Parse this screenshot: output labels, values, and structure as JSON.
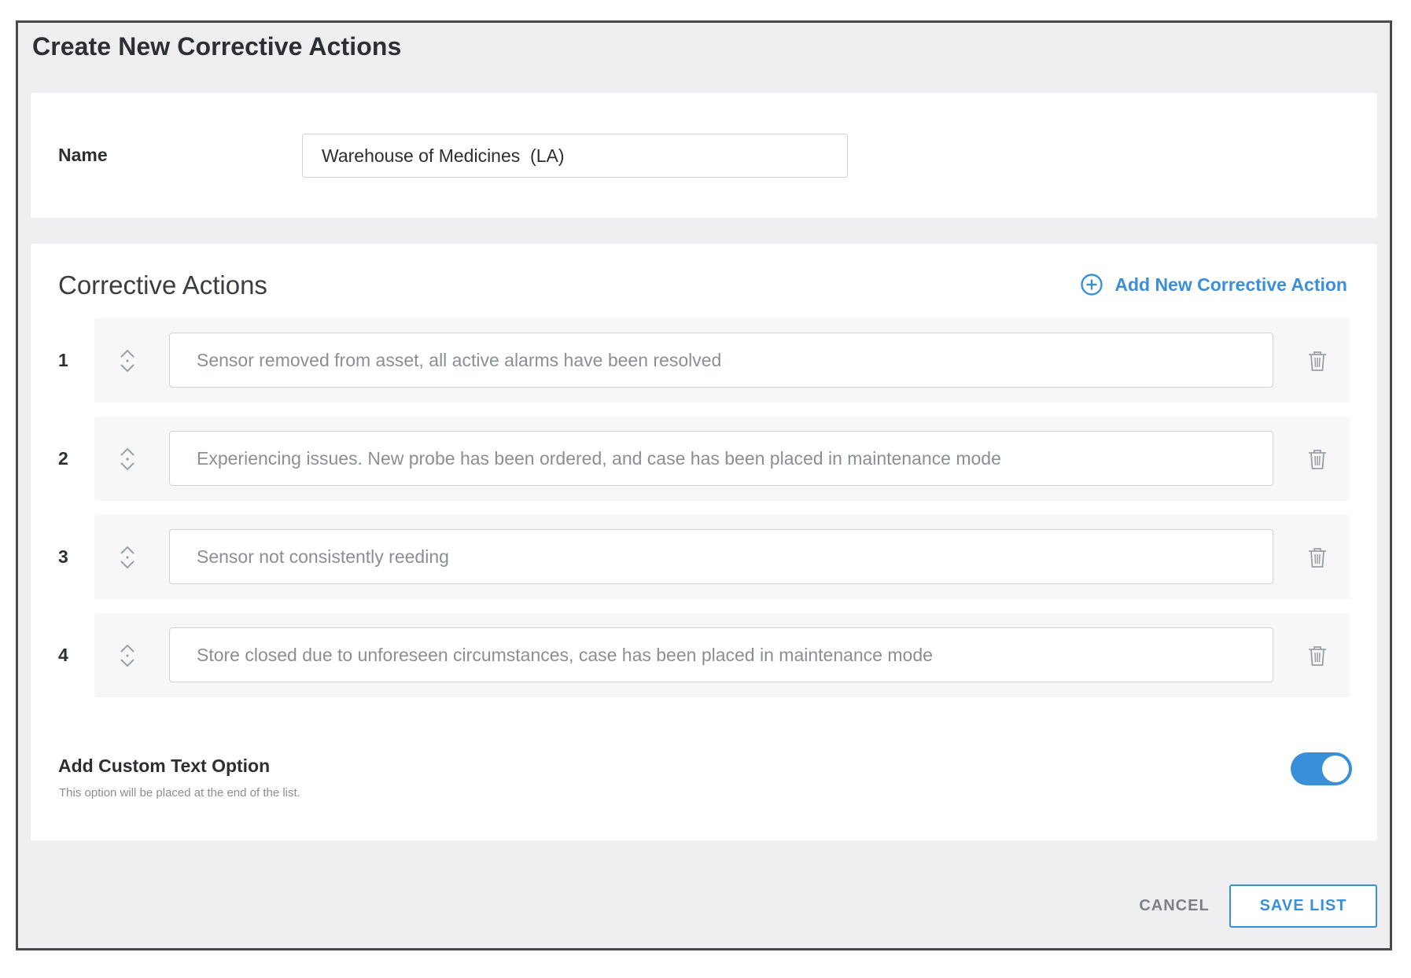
{
  "dialog": {
    "title": "Create New Corrective Actions"
  },
  "name_field": {
    "label": "Name",
    "value": "Warehouse of Medicines  (LA)"
  },
  "actions_section": {
    "title": "Corrective Actions",
    "add_label": "Add New Corrective Action",
    "items": [
      {
        "number": "1",
        "text": "Sensor removed from asset, all active alarms have been resolved"
      },
      {
        "number": "2",
        "text": "Experiencing issues. New probe has been ordered, and case has been placed in maintenance mode"
      },
      {
        "number": "3",
        "text": "Sensor not consistently reeding"
      },
      {
        "number": "4",
        "text": "Store closed due to unforeseen circumstances, case has been placed in maintenance mode"
      }
    ]
  },
  "custom_text": {
    "label": "Add Custom Text Option",
    "help": "This option will be placed at the end of the list.",
    "enabled": true
  },
  "footer": {
    "cancel_label": "CANCEL",
    "save_label": "SAVE LIST"
  },
  "colors": {
    "accent": "#3a8fd9",
    "dialog_bg": "#efeff1",
    "card_bg": "#ffffff",
    "row_bg": "#f7f7f8"
  },
  "icons": {
    "add": "plus-circle-icon",
    "reorder": "drag-handle-icon",
    "delete": "trash-icon"
  }
}
